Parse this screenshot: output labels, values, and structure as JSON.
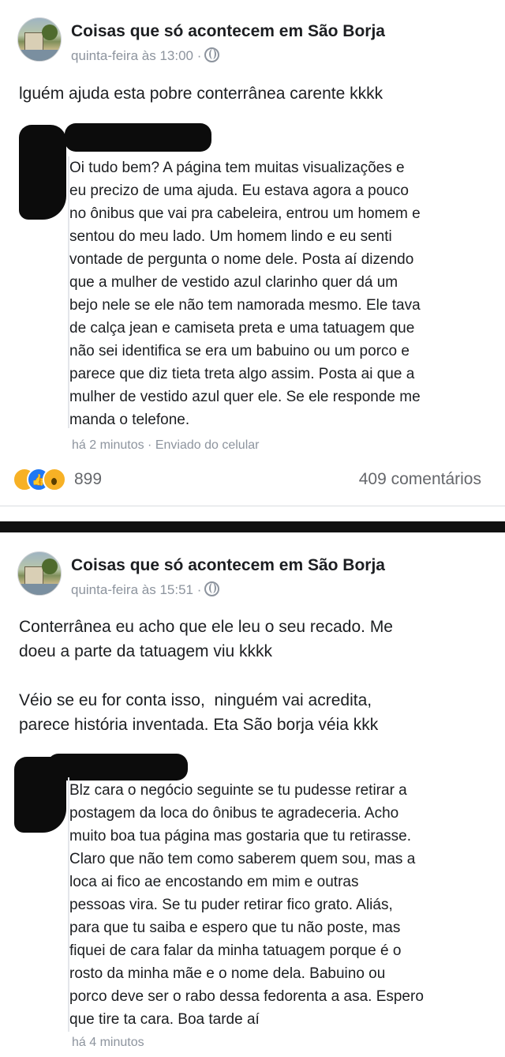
{
  "post1": {
    "page_name": "Coisas que só acontecem em São Borja",
    "timestamp": "quinta-feira às 13:00 ·",
    "caption": "lguém ajuda esta pobre conterrânea carente kkkk",
    "message_lines": [
      "Oi tudo bem? A página tem muitas visualizações e",
      "eu precizo de uma ajuda. Eu estava agora a pouco",
      "no ônibus que vai pra cabeleira, entrou um homem e",
      "sentou do meu lado. Um homem lindo e eu senti",
      "vontade de pergunta o nome dele. Posta aí dizendo",
      "que a mulher de vestido azul clarinho quer dá um",
      "bejo nele se ele não tem namorada mesmo. Ele tava",
      "de calça jean e camiseta preta e uma tatuagem que",
      "não sei identifica se era um babuino ou um porco e",
      "parece que diz tieta treta algo assim. Posta ai que a",
      "mulher de vestido azul quer ele. Se ele responde me",
      "manda o telefone."
    ],
    "message_meta": "há 2 minutos · Enviado do celular",
    "reactions": [
      "haha-icon",
      "like-icon",
      "wow-icon"
    ],
    "reaction_count": "899",
    "comments": "409 comentários"
  },
  "post2": {
    "page_name": "Coisas que só acontecem em São Borja",
    "timestamp": "quinta-feira às 15:51 ·",
    "caption_lines": [
      "Conterrânea eu acho que ele leu o seu recado. Me",
      "doeu a parte da tatuagem viu kkkk",
      "",
      "Véio se eu for conta isso,  ninguém vai acredita,",
      "parece história inventada. Eta São borja véia kkk"
    ],
    "message_lines": [
      "Blz cara o negócio seguinte se tu pudesse retirar a",
      "postagem da loca do ônibus te agradeceria. Acho",
      "muito boa tua página mas gostaria que tu retirasse.",
      "Claro que não tem como saberem quem sou, mas a",
      "loca ai fico ae encostando em mim e outras",
      "pessoas vira. Se tu puder retirar fico grato. Aliás,",
      "para que tu saiba e espero que tu não poste, mas",
      "fiquei de cara falar da minha tatuagem porque é o",
      "rosto da minha mãe e o nome dela. Babuino ou",
      "porco deve ser o rabo dessa fedorenta a asa. Espero",
      "que tire ta cara. Boa tarde aí"
    ],
    "message_meta": "há 4 minutos"
  },
  "colors": {
    "text": "#1c1e21",
    "muted": "#8d949e",
    "like_blue": "#2078f4",
    "reaction_yellow": "#f7b125",
    "redaction": "#0c0c0c"
  }
}
